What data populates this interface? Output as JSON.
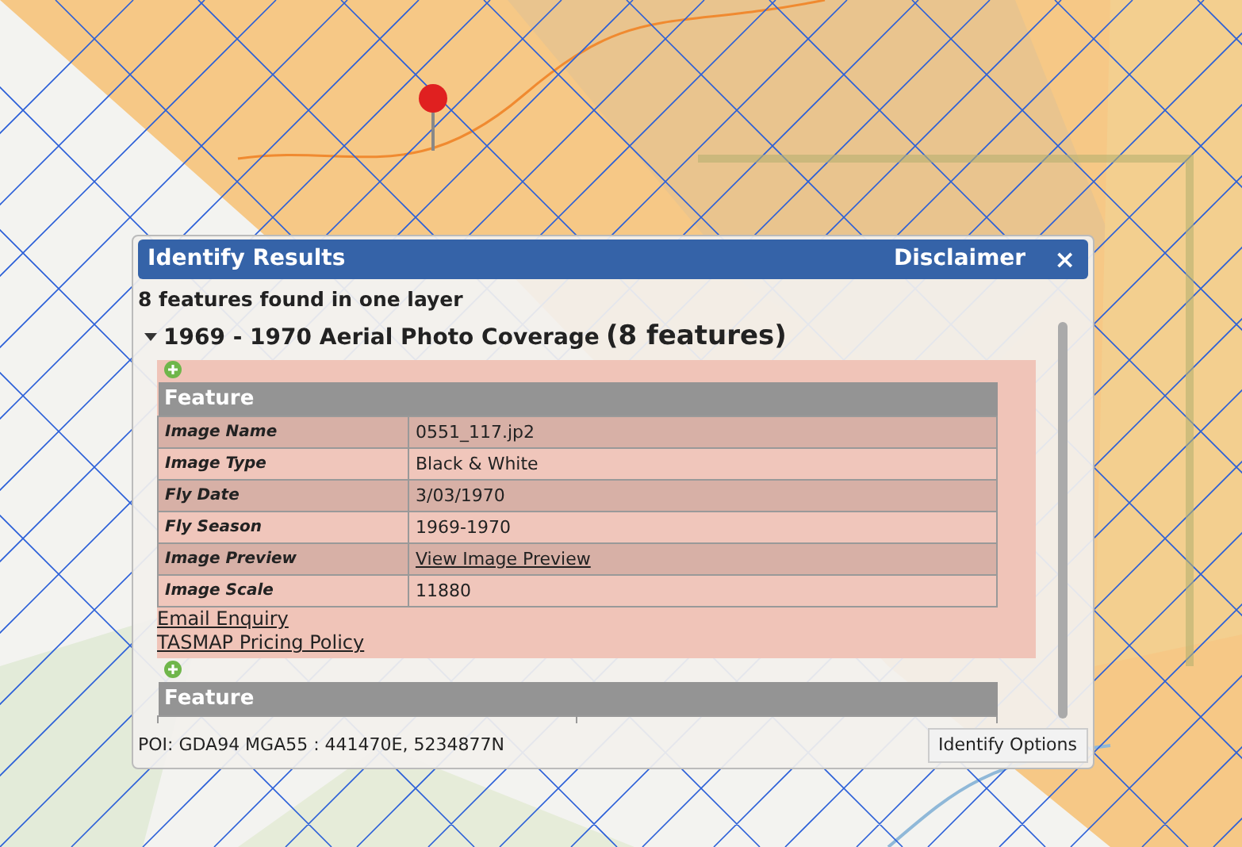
{
  "dialog": {
    "title": "Identify Results",
    "disclaimer": "Disclaimer",
    "close": "×",
    "summary": "8 features found in one layer",
    "layer": {
      "title": "1969 - 1970 Aerial Photo Coverage",
      "count": "(8 features)",
      "expanded": true
    },
    "features": [
      {
        "header": "Feature",
        "rows": [
          {
            "label": "Image Name",
            "value": "0551_117.jp2",
            "kind": "text"
          },
          {
            "label": "Image Type",
            "value": "Black & White",
            "kind": "text"
          },
          {
            "label": "Fly Date",
            "value": "3/03/1970",
            "kind": "text"
          },
          {
            "label": "Fly Season",
            "value": "1969-1970",
            "kind": "text"
          },
          {
            "label": "Image Preview",
            "value": "View Image Preview",
            "kind": "link"
          },
          {
            "label": "Image Scale",
            "value": "11880",
            "kind": "text"
          }
        ],
        "links": [
          "Email Enquiry",
          "TASMAP Pricing Policy"
        ]
      },
      {
        "header": "Feature"
      }
    ],
    "poi": "POI: GDA94 MGA55 : 441470E, 5234877N",
    "options_button": "Identify Options"
  }
}
